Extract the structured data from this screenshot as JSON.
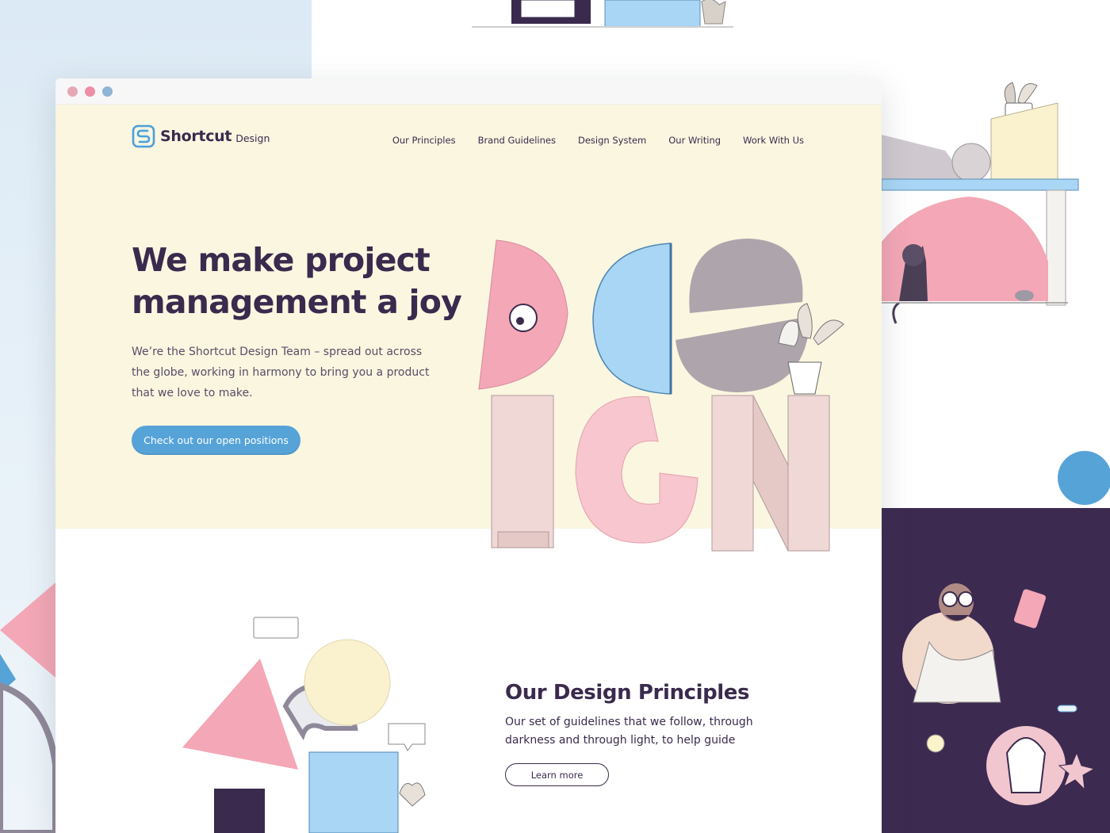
{
  "window": {
    "controls": [
      "close",
      "minimize",
      "maximize"
    ]
  },
  "brand": {
    "name": "Shortcut",
    "suffix": "Design",
    "logo_icon": "shortcut-s-logo"
  },
  "nav": {
    "items": [
      "Our Principles",
      "Brand Guidelines",
      "Design System",
      "Our Writing",
      "Work With Us"
    ]
  },
  "hero": {
    "title_line1": "We make project",
    "title_line2": "management a joy",
    "body": "We’re the Shortcut Design Team – spread out across the globe, working in harmony to bring you a product that we love to make.",
    "cta_label": "Check out our open positions",
    "illustration": "design-letters-illustration"
  },
  "principles": {
    "title": "Our Design Principles",
    "body": "Our set of guidelines that we follow, through darkness and through light, to help guide",
    "button_label": "Learn more",
    "illustration": "shapes-illustration"
  },
  "colors": {
    "hero_bg": "#faf6e0",
    "text_primary": "#3a2a4d",
    "accent_blue": "#56a3d8",
    "pink": "#f4a7b6",
    "grey": "#aea4ab",
    "plum": "#3d2a51"
  }
}
